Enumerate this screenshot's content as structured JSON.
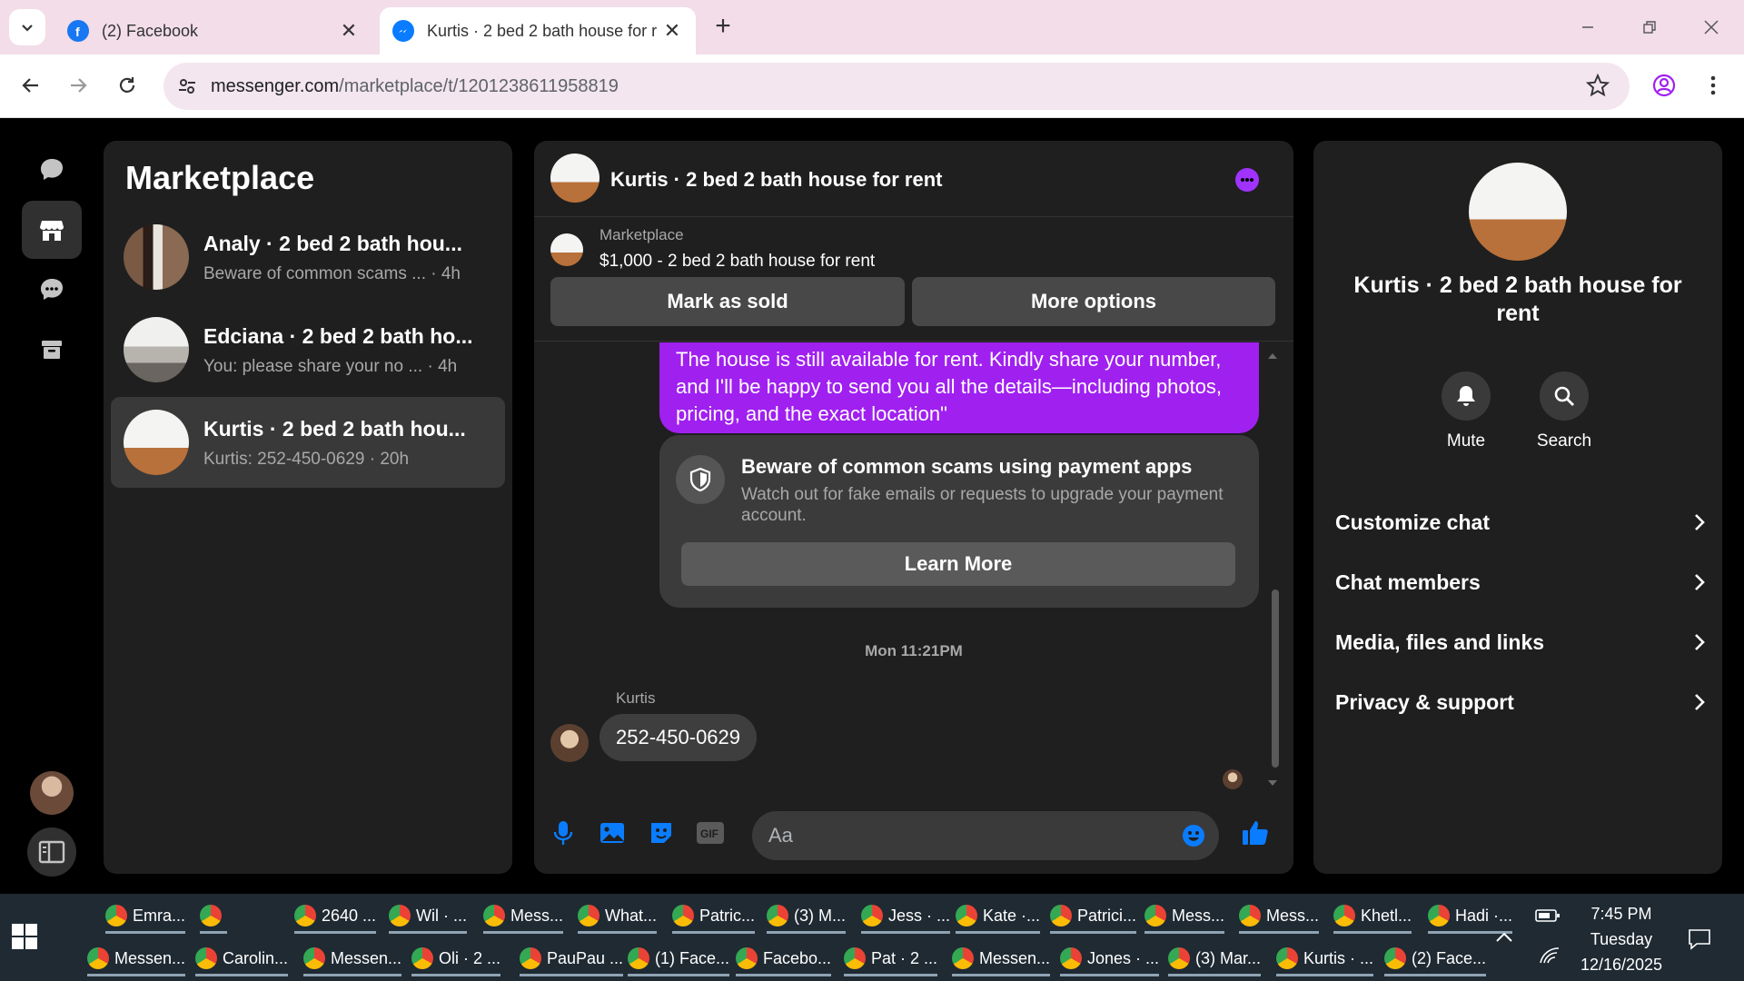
{
  "browser": {
    "tabs": [
      {
        "title": "(2) Facebook",
        "active": false
      },
      {
        "title": "Kurtis · 2 bed 2 bath house for r",
        "active": true
      }
    ],
    "url_host": "messenger.com",
    "url_path": "/marketplace/t/1201238611958819"
  },
  "sidebar": {
    "title": "Marketplace",
    "conversations": [
      {
        "name": "Analy · 2 bed 2 bath hou...",
        "preview": "Beware of common scams ... · 4h"
      },
      {
        "name": "Edciana · 2 bed 2 bath ho...",
        "preview": "You: please share your no ... · 4h"
      },
      {
        "name": "Kurtis · 2 bed 2 bath hou...",
        "preview": "Kurtis: 252-450-0629 · 20h"
      }
    ]
  },
  "chat": {
    "title": "Kurtis · 2 bed 2 bath house for rent",
    "listing_source": "Marketplace",
    "listing_price": "$1,000 - 2 bed 2 bath house for rent",
    "mark_sold_label": "Mark as sold",
    "more_options_label": "More options",
    "outgoing_message": "The house is still available for rent. Kindly share your number, and I'll be happy to send you all the details—including photos, pricing, and the exact location\"",
    "scam_title": "Beware of common scams using payment apps",
    "scam_desc": "Watch out for fake emails or requests to upgrade your payment account.",
    "learn_more_label": "Learn More",
    "timestamp": "Mon 11:21PM",
    "sender": "Kurtis",
    "incoming_message": "252-450-0629",
    "input_placeholder": "Aa"
  },
  "info": {
    "title": "Kurtis · 2 bed 2 bath house for rent",
    "mute_label": "Mute",
    "search_label": "Search",
    "rows": [
      "Customize chat",
      "Chat members",
      "Media, files and links",
      "Privacy & support"
    ]
  },
  "taskbar": {
    "row1": [
      "Emra...",
      "",
      "2640 ...",
      "Wil · ...",
      "Mess...",
      "What...",
      "Patric...",
      "(3) M...",
      "Jess · ...",
      "Kate ·...",
      "Patrici...",
      "Mess...",
      "Mess...",
      "Khetl...",
      "Hadi ·..."
    ],
    "row2": [
      "Messen...",
      "Carolin...",
      "Messen...",
      "Oli · 2 ...",
      "PauPau ...",
      "(1) Face...",
      "Facebo...",
      "Pat · 2 ...",
      "Messen...",
      "Jones · ...",
      "(3) Mar...",
      "Kurtis · ...",
      "(2) Face..."
    ],
    "time": "7:45 PM",
    "day": "Tuesday",
    "date": "12/16/2025"
  },
  "colors": {
    "accent": "#a020f0",
    "messenger_blue": "#0a7cff",
    "panel": "#1f1f1f"
  }
}
